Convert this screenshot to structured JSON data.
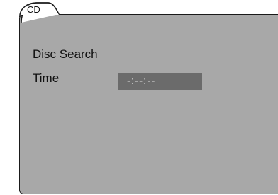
{
  "screen": {
    "tab_label": "CD",
    "menu": {
      "disc_search_label": "Disc Search",
      "time_label": "Time",
      "time_value": "-:--:--"
    }
  },
  "colors": {
    "panel_background": "#a8a8a8",
    "field_background": "#6b6b6b",
    "field_text": "#e2e2e2",
    "text": "#111111",
    "border": "#1a1a1a"
  }
}
